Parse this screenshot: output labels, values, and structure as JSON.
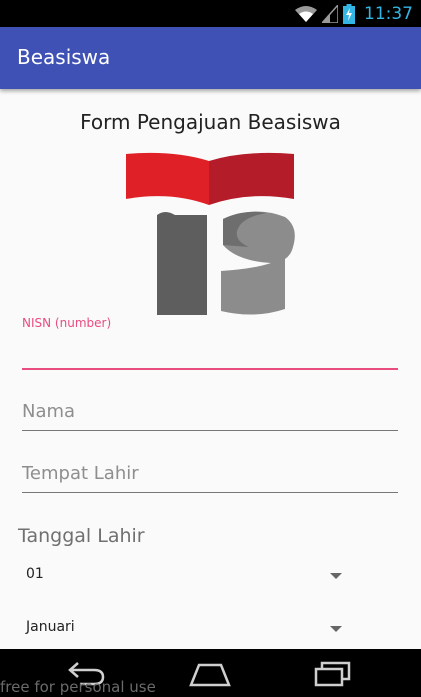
{
  "status_bar": {
    "time": "11:37",
    "icons": [
      "wifi-icon",
      "signal-icon",
      "battery-charging-icon"
    ],
    "accent_color": "#33b5e5"
  },
  "app_bar": {
    "title": "Beasiswa",
    "color": "#3f51b5"
  },
  "form": {
    "title": "Form Pengajuan Beasiswa",
    "logo": {
      "colors": [
        "#e02027",
        "#b51c2a",
        "#5e5e5e",
        "#8c8c8c"
      ]
    },
    "nisn": {
      "label": "NISN (number)",
      "value": ""
    },
    "nama": {
      "placeholder": "Nama",
      "value": ""
    },
    "tempat_lahir": {
      "placeholder": "Tempat Lahir",
      "value": ""
    },
    "tanggal_lahir": {
      "label": "Tanggal Lahir",
      "day": "01",
      "month": "Januari"
    },
    "accent_color": "#e94c7e"
  },
  "nav_bar": {
    "buttons": [
      "back-icon",
      "home-icon",
      "recents-icon"
    ]
  },
  "watermark": "free for personal use"
}
